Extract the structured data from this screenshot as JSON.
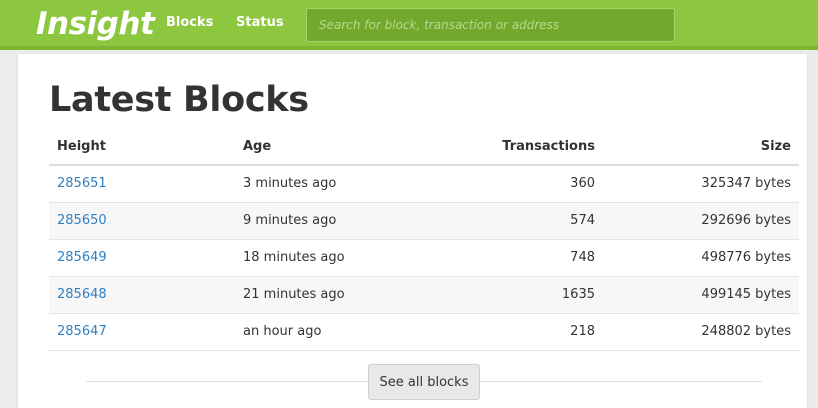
{
  "navbar": {
    "brand": "Insight",
    "links": [
      "Blocks",
      "Status"
    ],
    "search_placeholder": "Search for block, transaction or address",
    "colors": {
      "background": "#8dc63f",
      "search_bg": "#72a82c"
    }
  },
  "main": {
    "title": "Latest Blocks",
    "table": {
      "headers": [
        "Height",
        "Age",
        "Transactions",
        "Size"
      ],
      "rows": [
        [
          "285651",
          "3 minutes ago",
          "360",
          "325347 bytes"
        ],
        [
          "285650",
          "9 minutes ago",
          "574",
          "292696 bytes"
        ],
        [
          "285649",
          "18 minutes ago",
          "748",
          "498776 bytes"
        ],
        [
          "285648",
          "21 minutes ago",
          "1635",
          "499145 bytes"
        ],
        [
          "285647",
          "an hour ago",
          "218",
          "248802 bytes"
        ]
      ]
    },
    "see_all_label": "See all blocks",
    "link_color": "#2f7fc1"
  }
}
